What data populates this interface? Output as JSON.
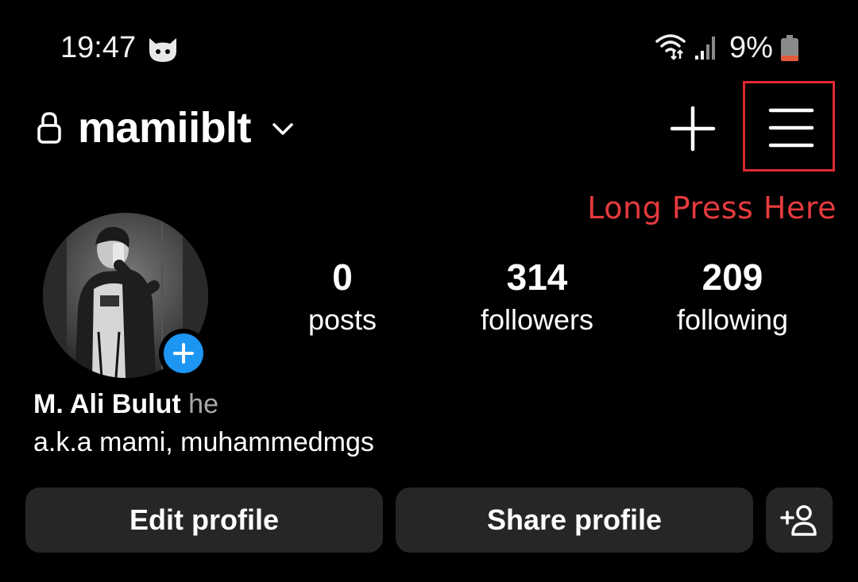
{
  "status_bar": {
    "time": "19:47",
    "battery_percent": "9%",
    "battery_level": 0.09,
    "battery_color": "#e25a3c",
    "icons": [
      "cat-notification-icon",
      "wifi-data-icon",
      "signal-icon",
      "battery-icon"
    ]
  },
  "header": {
    "username": "mamiiblt",
    "icons": [
      "lock-icon",
      "chevron-down-icon",
      "plus-icon",
      "menu-icon"
    ]
  },
  "annotation": {
    "text": "Long Press Here",
    "color": "#e0292f"
  },
  "stats": [
    {
      "value": "0",
      "label": "posts"
    },
    {
      "value": "314",
      "label": "followers"
    },
    {
      "value": "209",
      "label": "following"
    }
  ],
  "bio": {
    "full_name": "M. Ali Bulut",
    "pronoun": "he",
    "text": "a.k.a mami, muhammedmgs"
  },
  "buttons": {
    "edit_profile": "Edit profile",
    "share_profile": "Share profile",
    "add_person_icon": "add-person-icon"
  },
  "colors": {
    "background": "#000000",
    "button_bg": "#262626",
    "accent_blue": "#1d95f2",
    "muted_text": "#a8a8a8"
  }
}
